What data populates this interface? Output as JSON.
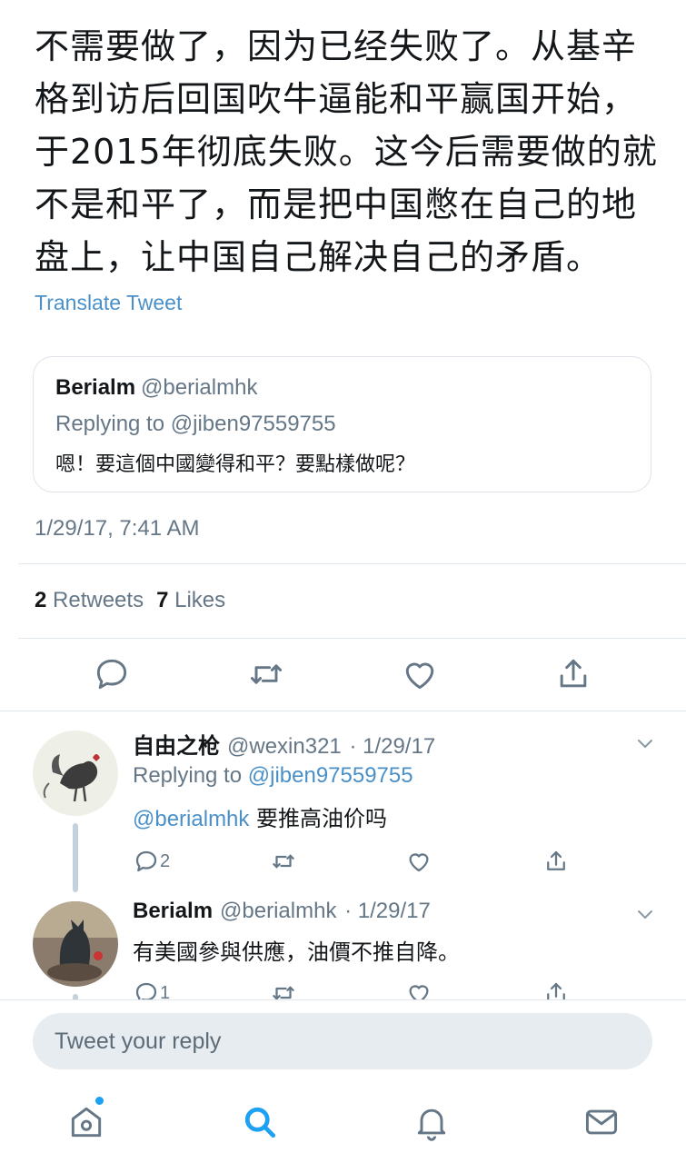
{
  "tweet": {
    "text": "不需要做了，因为已经失败了。从基辛格到访后回国吹牛逼能和平赢国开始，于2015年彻底失败。这今后需要做的就不是和平了，而是把中国憋在自己的地盘上，让中国自己解决自己的矛盾。",
    "translate_label": "Translate Tweet",
    "timestamp": "1/29/17, 7:41 AM",
    "retweets_count": "2",
    "retweets_label": "Retweets",
    "likes_count": "7",
    "likes_label": "Likes"
  },
  "quoted": {
    "name": "Berialm",
    "handle": "@berialmhk",
    "replying_prefix": "Replying to",
    "replying_to": "@jiben97559755",
    "text": "嗯！要這個中國變得和平？要點樣做呢？"
  },
  "replies": [
    {
      "name": "自由之枪",
      "handle": "@wexin321",
      "date": "· 1/29/17",
      "replying_prefix": "Replying to",
      "replying_to": "@jiben97559755",
      "mention": "@berialmhk",
      "text": "要推高油价吗",
      "reply_count": "2"
    },
    {
      "name": "Berialm",
      "handle": "@berialmhk",
      "date": "· 1/29/17",
      "text": "有美國參與供應，油價不推自降。",
      "reply_count": "1"
    }
  ],
  "composer": {
    "placeholder": "Tweet your reply"
  },
  "colors": {
    "accent": "#1da1f2",
    "link": "#4a90c8",
    "secondary": "#657786"
  }
}
